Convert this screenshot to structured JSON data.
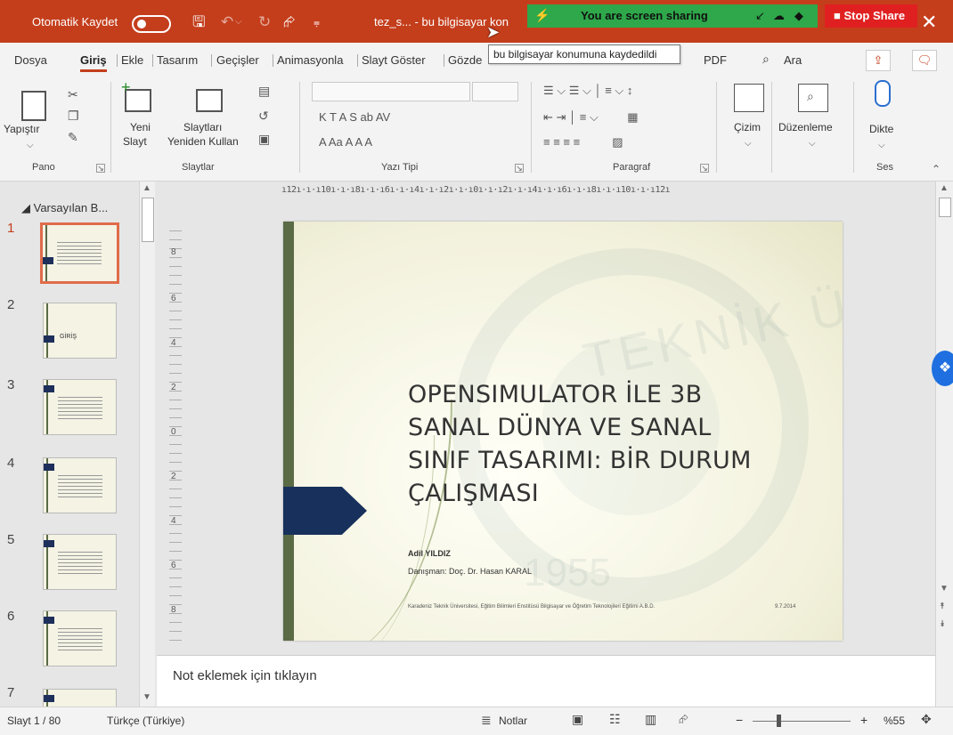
{
  "titlebar": {
    "autosave_label": "Otomatik Kaydet",
    "doc_title": "tez_s...  -  bu bilgisayar kon",
    "screen_share_text": "You are screen sharing",
    "stop_share_label": "Stop Share",
    "tooltip": "bu bilgisayar konumuna kaydedildi"
  },
  "menu": {
    "tabs": [
      "Dosya",
      "Giriş",
      "Ekle",
      "Tasarım",
      "Geçişler",
      "Animasyonla",
      "Slayt Göster",
      "Gözde",
      "PDF"
    ],
    "active_tab": "Giriş",
    "search_label": "Ara"
  },
  "ribbon": {
    "pano": {
      "paste_label": "Yapıştır",
      "group_label": "Pano"
    },
    "slaytlar": {
      "new_slide_label_1": "Yeni",
      "new_slide_label_2": "Slayt",
      "reuse_label_1": "Slaytları",
      "reuse_label_2": "Yeniden Kullan",
      "group_label": "Slaytlar"
    },
    "yazi_tipi": {
      "group_label": "Yazı Tipi",
      "format_row": "K  T  A  S  ab  AV",
      "color_row": "A  Aa  A  A  A"
    },
    "paragraf": {
      "group_label": "Paragraf"
    },
    "cizim": {
      "label": "Çizim"
    },
    "duzenleme": {
      "label": "Düzenleme"
    },
    "ses": {
      "dikte_label": "Dikte",
      "group_label": "Ses"
    }
  },
  "thumbnails": {
    "section_label": "Varsayılan B...",
    "numbers": [
      "1",
      "2",
      "3",
      "4",
      "5",
      "6",
      "7"
    ],
    "slide2_label": "GİRİŞ"
  },
  "ruler": {
    "horizontal": "ı12ı·ı·ı10ı·ı·ı8ı·ı·ı6ı·ı·ı4ı·ı·ı2ı·ı·ı0ı·ı·ı2ı·ı·ı4ı·ı·ı6ı·ı·ı8ı·ı·ı10ı·ı·ı12ı",
    "vertical": [
      "8",
      "6",
      "4",
      "2",
      "0",
      "2",
      "4",
      "6",
      "8"
    ]
  },
  "slide": {
    "title_lines": [
      "OPENSIMULATOR İLE 3B",
      "SANAL DÜNYA VE SANAL",
      "SINIF TASARIMI: BİR DURUM",
      "ÇALIŞMASI"
    ],
    "author": "Adil YILDIZ",
    "advisor": "Danışman: Doç. Dr. Hasan KARAL",
    "footer": "Karadeniz Teknik Üniversitesi, Eğitim Bilimleri Enstitüsü Bilgisayar ve Öğretim Teknolojileri Eğitimi A.B.D.",
    "date": "9.7.2014",
    "watermark_text": "TEKNİK ÜNİVERSİTESİ",
    "watermark_year": "1955"
  },
  "notes_placeholder": "Not eklemek için tıklayın",
  "statusbar": {
    "slide_info": "Slayt 1 / 80",
    "language": "Türkçe (Türkiye)",
    "notes_label": "Notlar",
    "zoom_label": "%55",
    "zoom_percent": 55
  },
  "colors": {
    "accent": "#c43e1c",
    "share_green": "#2ea84a",
    "stop_red": "#e02020",
    "slide_arrow": "#17305c",
    "slide_bar": "#5a6a45"
  }
}
